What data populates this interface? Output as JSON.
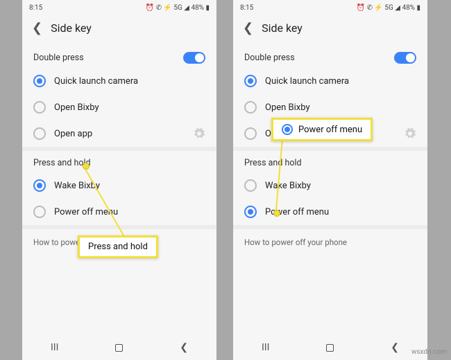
{
  "status": {
    "time": "8:15",
    "indicators": "⏰ ✆ ⚡ 5G ◢ 48% ▮"
  },
  "header": {
    "title": "Side key"
  },
  "section_double": {
    "label": "Double press",
    "options": {
      "camera": "Quick launch camera",
      "bixby": "Open Bixby",
      "app": "Open app"
    }
  },
  "section_hold": {
    "label": "Press and hold",
    "options": {
      "wake": "Wake Bixby",
      "poweroff": "Power off menu"
    }
  },
  "footnote": "How to power off your phone",
  "callouts": {
    "left": "Press and hold",
    "right": "Power off menu"
  },
  "phone2_open_app_truncated": "Op",
  "watermark": "wsxdn.com"
}
